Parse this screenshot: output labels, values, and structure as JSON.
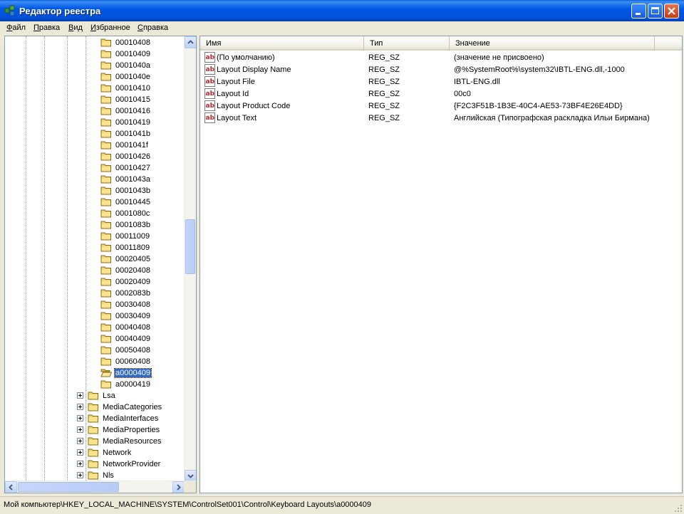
{
  "window": {
    "title": "Редактор реестра"
  },
  "menu": [
    "Файл",
    "Правка",
    "Вид",
    "Избранное",
    "Справка"
  ],
  "menu_accel": [
    "Ф",
    "П",
    "В",
    "И",
    "С"
  ],
  "tree": {
    "children": [
      "00010408",
      "00010409",
      "0001040a",
      "0001040e",
      "00010410",
      "00010415",
      "00010416",
      "00010419",
      "0001041b",
      "0001041f",
      "00010426",
      "00010427",
      "0001043a",
      "0001043b",
      "00010445",
      "0001080c",
      "0001083b",
      "00011009",
      "00011809",
      "00020405",
      "00020408",
      "00020409",
      "0002083b",
      "00030408",
      "00030409",
      "00040408",
      "00040409",
      "00050408",
      "00060408",
      "a0000409",
      "a0000419"
    ],
    "selected": "a0000409",
    "siblings": [
      "Lsa",
      "MediaCategories",
      "MediaInterfaces",
      "MediaProperties",
      "MediaResources",
      "Network",
      "NetworkProvider",
      "Nls"
    ]
  },
  "list": {
    "columns": [
      "Имя",
      "Тип",
      "Значение"
    ],
    "rows": [
      {
        "name": "(По умолчанию)",
        "type": "REG_SZ",
        "value": "(значение не присвоено)"
      },
      {
        "name": "Layout Display Name",
        "type": "REG_SZ",
        "value": "@%SystemRoot%\\system32\\IBTL-ENG.dll,-1000"
      },
      {
        "name": "Layout File",
        "type": "REG_SZ",
        "value": "IBTL-ENG.dll"
      },
      {
        "name": "Layout Id",
        "type": "REG_SZ",
        "value": "00c0"
      },
      {
        "name": "Layout Product Code",
        "type": "REG_SZ",
        "value": "{F2C3F51B-1B3E-40C4-AE53-73BF4E26E4DD}"
      },
      {
        "name": "Layout Text",
        "type": "REG_SZ",
        "value": "Английская (Типографская раскладка Ильи Бирмана)"
      }
    ]
  },
  "status": {
    "path": "Мой компьютер\\HKEY_LOCAL_MACHINE\\SYSTEM\\ControlSet001\\Control\\Keyboard Layouts\\a0000409"
  },
  "icons": {
    "folder": "folder-icon",
    "string_value": "reg-sz-icon",
    "app": "regedit-icon"
  },
  "colors": {
    "title_bar": "#0058e6",
    "selection": "#316ac5",
    "close_button": "#c53b14"
  }
}
